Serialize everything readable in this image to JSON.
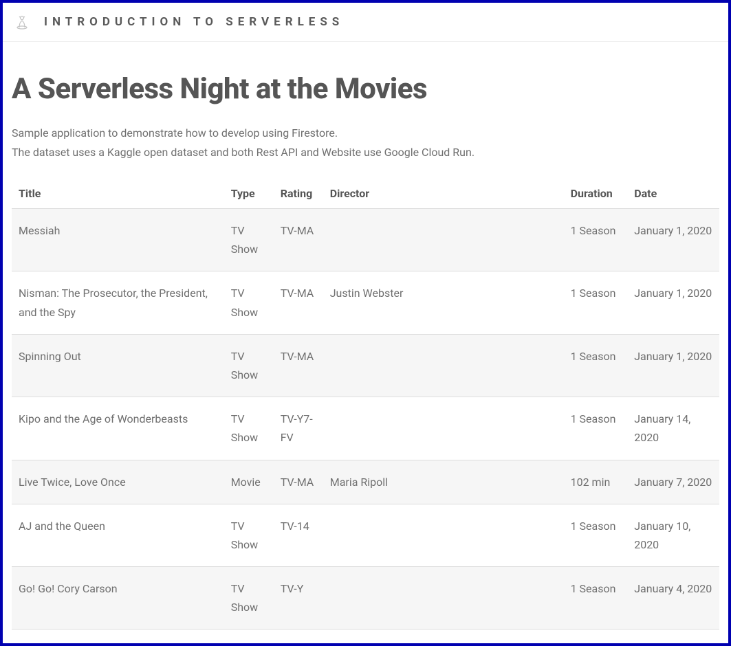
{
  "header": {
    "title": "INTRODUCTION TO SERVERLESS"
  },
  "main": {
    "title": "A Serverless Night at the Movies",
    "intro_line1": "Sample application to demonstrate how to develop using Firestore.",
    "intro_line2": "The dataset uses a Kaggle open dataset and both Rest API and Website use Google Cloud Run."
  },
  "table": {
    "headers": {
      "title": "Title",
      "type": "Type",
      "rating": "Rating",
      "director": "Director",
      "duration": "Duration",
      "date": "Date"
    },
    "rows": [
      {
        "title": "Messiah",
        "type": "TV Show",
        "rating": "TV-MA",
        "director": "",
        "duration": "1 Season",
        "date": "January 1, 2020"
      },
      {
        "title": "Nisman: The Prosecutor, the President, and the Spy",
        "type": "TV Show",
        "rating": "TV-MA",
        "director": "Justin Webster",
        "duration": "1 Season",
        "date": "January 1, 2020"
      },
      {
        "title": "Spinning Out",
        "type": "TV Show",
        "rating": "TV-MA",
        "director": "",
        "duration": "1 Season",
        "date": "January 1, 2020"
      },
      {
        "title": "Kipo and the Age of Wonderbeasts",
        "type": "TV Show",
        "rating": "TV-Y7-FV",
        "director": "",
        "duration": "1 Season",
        "date": "January 14, 2020"
      },
      {
        "title": "Live Twice, Love Once",
        "type": "Movie",
        "rating": "TV-MA",
        "director": "Maria Ripoll",
        "duration": "102 min",
        "date": "January 7, 2020"
      },
      {
        "title": "AJ and the Queen",
        "type": "TV Show",
        "rating": "TV-14",
        "director": "",
        "duration": "1 Season",
        "date": "January 10, 2020"
      },
      {
        "title": "Go! Go! Cory Carson",
        "type": "TV Show",
        "rating": "TV-Y",
        "director": "",
        "duration": "1 Season",
        "date": "January 4, 2020"
      }
    ]
  }
}
